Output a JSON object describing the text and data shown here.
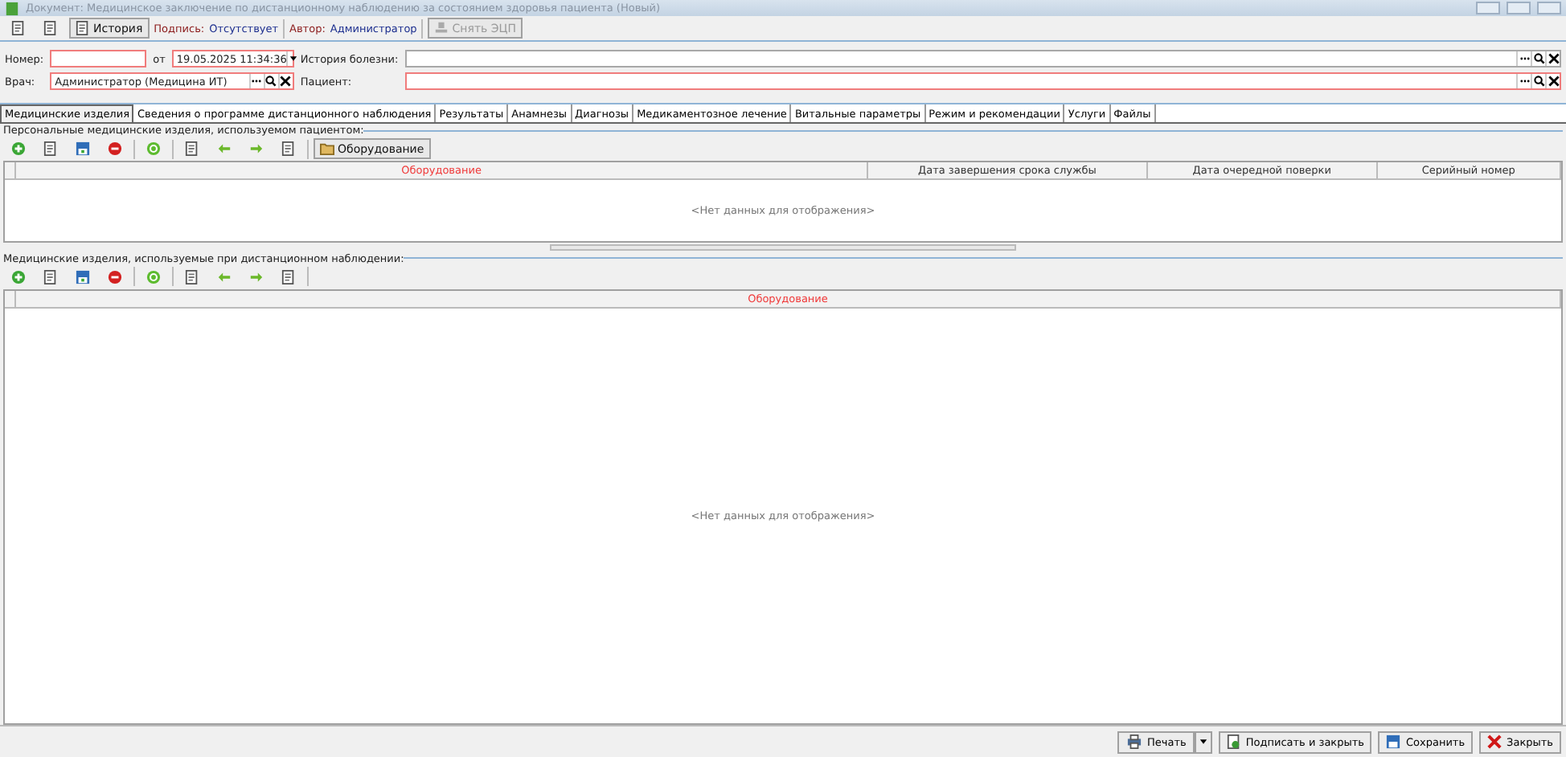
{
  "window": {
    "title": "Документ: Медицинское заключение по дистанционному наблюдению за состоянием здоровья пациента (Новый)"
  },
  "toolbar": {
    "history_button": "История",
    "signature_label": "Подпись:",
    "signature_value": "Отсутствует",
    "author_label": "Автор:",
    "author_value": "Администратор",
    "remove_signature_button": {
      "label": "Снять ЭЦП",
      "disabled": true
    }
  },
  "form": {
    "number": {
      "label": "Номер:",
      "required": true
    },
    "date_label": "от",
    "date": {
      "value": "19.05.2025 11:34:36",
      "required": true
    },
    "history": {
      "label": "История болезни:",
      "required": false
    },
    "doctor": {
      "label": "Врач:",
      "value": "Администратор (Медицина ИТ)",
      "required": true
    },
    "patient": {
      "label": "Пациент:",
      "required": true
    }
  },
  "tabs": [
    {
      "label": "Медицинские изделия",
      "selected": true
    },
    {
      "label": "Сведения о программе дистанционного наблюдения",
      "selected": false
    },
    {
      "label": "Результаты",
      "selected": false
    },
    {
      "label": "Анамнезы",
      "selected": false
    },
    {
      "label": "Диагнозы",
      "selected": false
    },
    {
      "label": "Медикаментозное лечение",
      "selected": false
    },
    {
      "label": "Витальные параметры",
      "selected": false
    },
    {
      "label": "Режим и рекомендации",
      "selected": false
    },
    {
      "label": "Услуги",
      "selected": false
    },
    {
      "label": "Файлы",
      "selected": false
    }
  ],
  "sections": [
    {
      "title": "Персональные медицинские изделия, используемом пациентом:",
      "toolbar_button": "Оборудование",
      "columns": [
        {
          "label": "Оборудование",
          "required": true
        },
        {
          "label": "Дата завершения срока службы",
          "required": false
        },
        {
          "label": "Дата очередной поверки",
          "required": false
        },
        {
          "label": "Серийный номер",
          "required": false
        }
      ],
      "empty_text": "<Нет данных для отображения>"
    },
    {
      "title": "Медицинские изделия, используемые при дистанционном наблюдении:",
      "columns": [
        {
          "label": "Оборудование",
          "required": true
        }
      ],
      "empty_text": "<Нет данных для отображения>"
    }
  ],
  "footer": [
    {
      "kind": "print",
      "label": "Печать"
    },
    {
      "kind": "sign",
      "label": "Подписать и закрыть"
    },
    {
      "kind": "save",
      "label": "Сохранить"
    },
    {
      "kind": "close",
      "label": "Закрыть"
    }
  ]
}
